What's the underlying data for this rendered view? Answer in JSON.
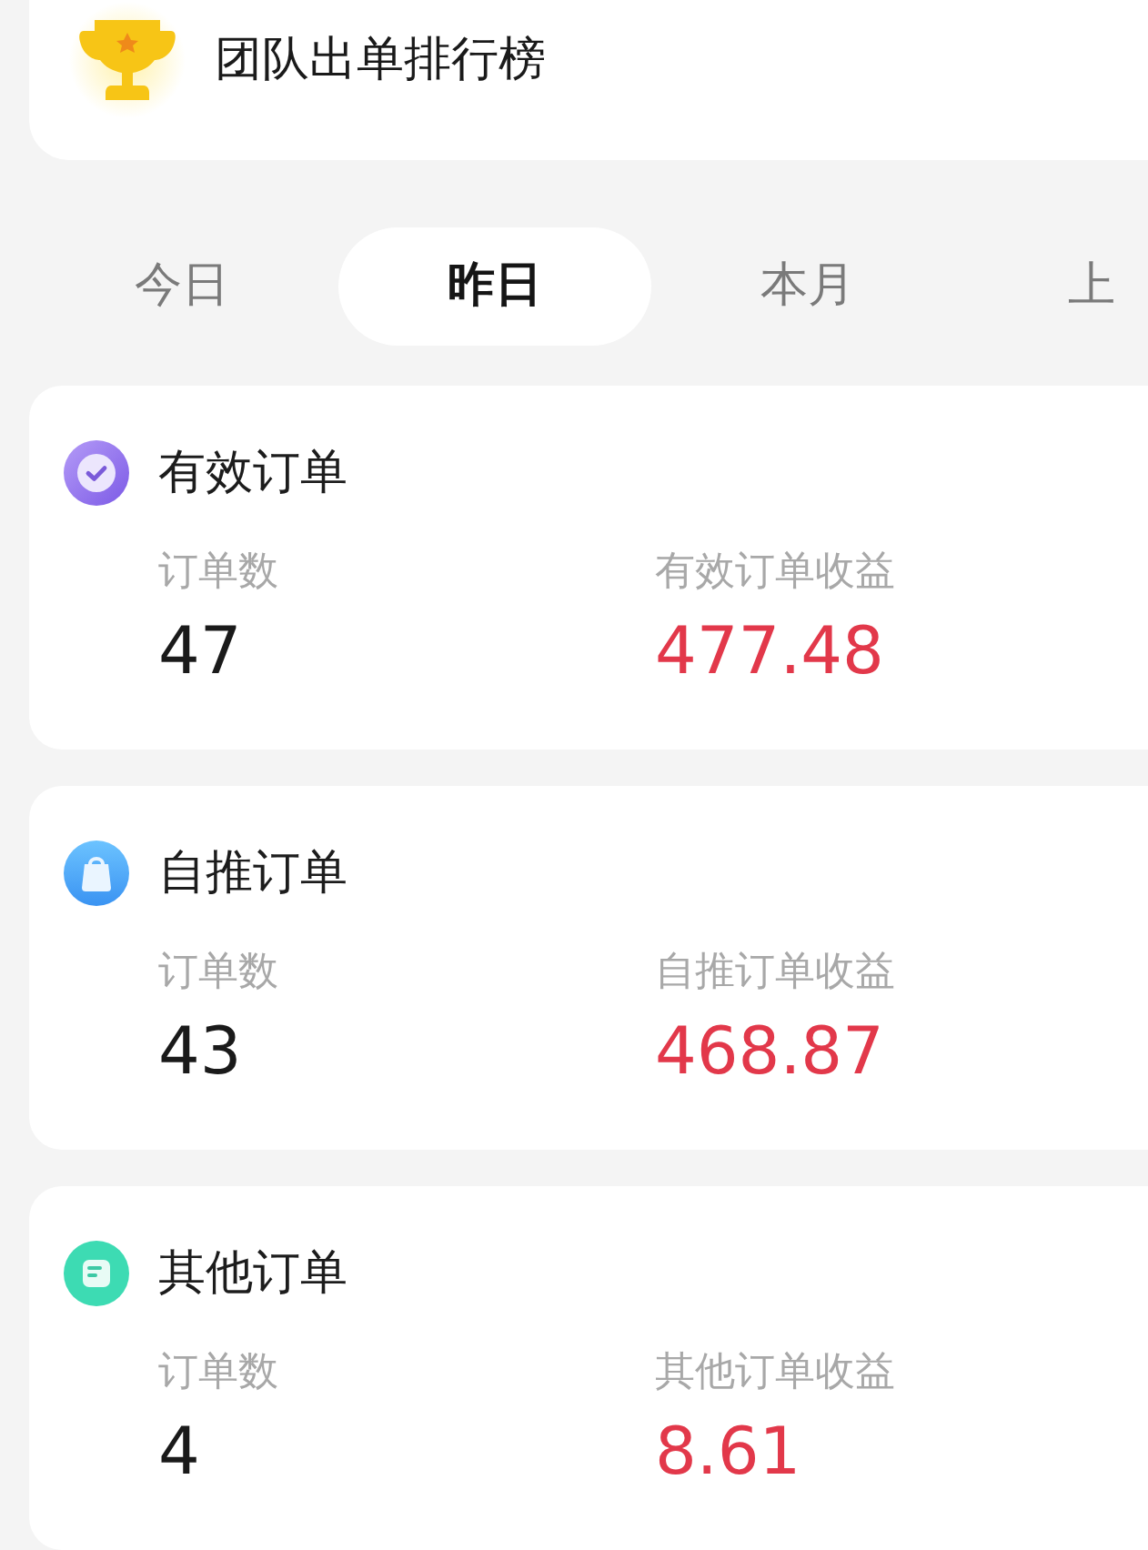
{
  "header": {
    "title": "团队出单排行榜"
  },
  "tabs": [
    {
      "label": "今日",
      "selected": false
    },
    {
      "label": "昨日",
      "selected": true
    },
    {
      "label": "本月",
      "selected": false
    },
    {
      "label": "上",
      "selected": false
    }
  ],
  "sections": [
    {
      "kind": "valid",
      "title": "有效订单",
      "count_label": "订单数",
      "count": "47",
      "income_label": "有效订单收益",
      "income": "477.48"
    },
    {
      "kind": "self",
      "title": "自推订单",
      "count_label": "订单数",
      "count": "43",
      "income_label": "自推订单收益",
      "income": "468.87"
    },
    {
      "kind": "other",
      "title": "其他订单",
      "count_label": "订单数",
      "count": "4",
      "income_label": "其他订单收益",
      "income": "8.61"
    }
  ]
}
